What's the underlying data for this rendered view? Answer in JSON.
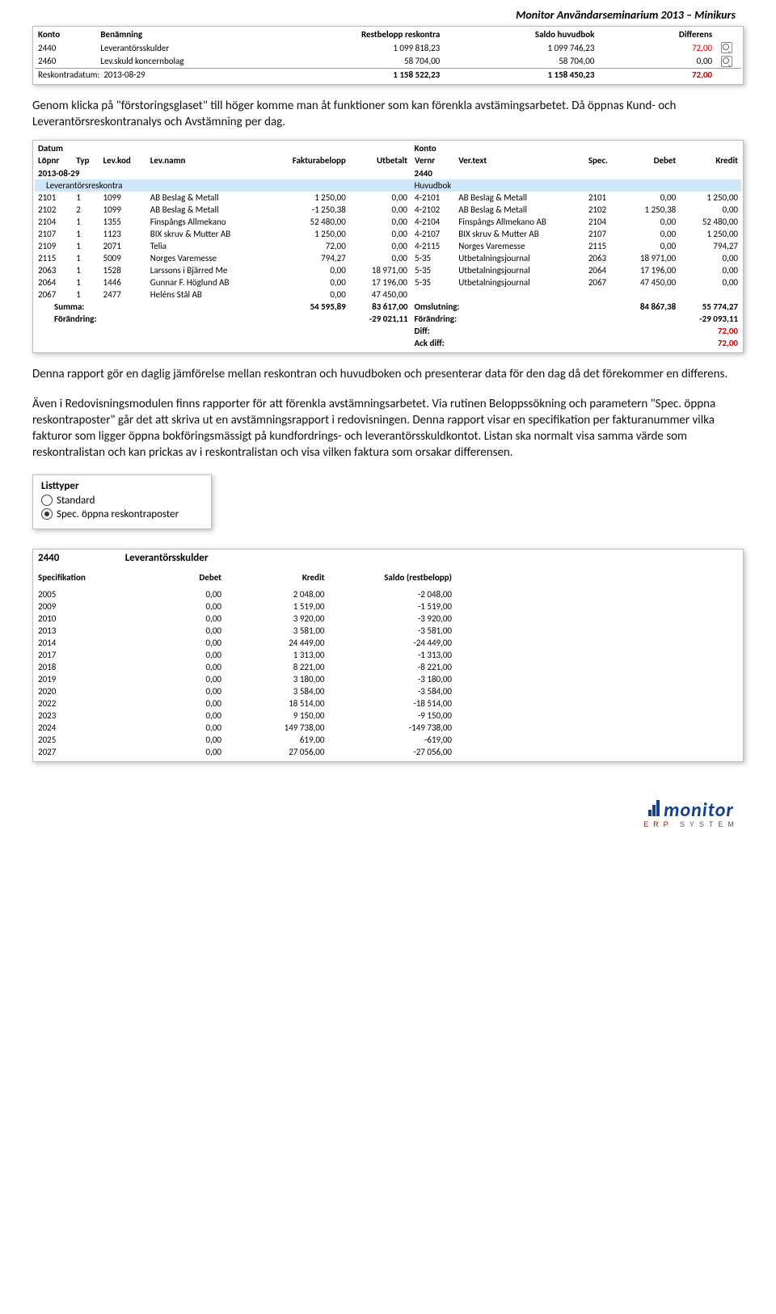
{
  "header_text": "Monitor Användarseminarium 2013 – Minikurs",
  "table1": {
    "headers": [
      "Konto",
      "Benämning",
      "Restbelopp reskontra",
      "Saldo huvudbok",
      "Differens"
    ],
    "rows": [
      {
        "konto": "2440",
        "benamning": "Leverantörsskulder",
        "rest": "1 099 818,23",
        "saldo": "1 099 746,23",
        "diff": "72,00",
        "diffred": true,
        "mag": true
      },
      {
        "konto": "2460",
        "benamning": "Lev.skuld koncernbolag",
        "rest": "58 704,00",
        "saldo": "58 704,00",
        "diff": "0,00",
        "diffred": false,
        "mag": true
      }
    ],
    "footer": {
      "label": "Reskontradatum:",
      "date": "2013-08-29",
      "rest": "1 158 522,23",
      "saldo": "1 158 450,23",
      "diff": "72,00"
    }
  },
  "paragraph1_a": "Genom klicka på \"förstoringsglaset\" till höger komme man åt funktioner som kan förenkla avstämingsarbetet. Då öppnas Kund- och Leverantörsreskontranalys och Avstämning per dag.",
  "table2": {
    "left_headers": [
      "Datum",
      "",
      "",
      "",
      "",
      "",
      "",
      ""
    ],
    "left_sub": [
      "Löpnr",
      "Typ",
      "Lev.kod",
      "Lev.namn",
      "Fakturabelopp",
      "Utbetalt"
    ],
    "right_sub": [
      "Konto",
      "Vernr",
      "Ver.text",
      "Spec.",
      "Debet",
      "Kredit"
    ],
    "date": "2013-08-29",
    "konto": "2440",
    "left_label": "Leverantörsreskontra",
    "right_label": "Huvudbok",
    "rows_left": [
      {
        "lopnr": "2101",
        "typ": "1",
        "kod": "1099",
        "namn": "AB Beslag & Metall",
        "fb": "1 250,00",
        "ut": "0,00"
      },
      {
        "lopnr": "2102",
        "typ": "2",
        "kod": "1099",
        "namn": "AB Beslag & Metall",
        "fb": "-1 250,38",
        "ut": "0,00"
      },
      {
        "lopnr": "2104",
        "typ": "1",
        "kod": "1355",
        "namn": "Finspångs Allmekano",
        "fb": "52 480,00",
        "ut": "0,00"
      },
      {
        "lopnr": "2107",
        "typ": "1",
        "kod": "1123",
        "namn": "BIX skruv & Mutter AB",
        "fb": "1 250,00",
        "ut": "0,00"
      },
      {
        "lopnr": "2109",
        "typ": "1",
        "kod": "2071",
        "namn": "Telia",
        "fb": "72,00",
        "ut": "0,00"
      },
      {
        "lopnr": "2115",
        "typ": "1",
        "kod": "5009",
        "namn": "Norges Varemesse",
        "fb": "794,27",
        "ut": "0,00"
      },
      {
        "lopnr": "2063",
        "typ": "1",
        "kod": "1528",
        "namn": "Larssons i Bjärred Me",
        "fb": "0,00",
        "ut": "18 971,00"
      },
      {
        "lopnr": "2064",
        "typ": "1",
        "kod": "1446",
        "namn": "Gunnar F. Höglund AB",
        "fb": "0,00",
        "ut": "17 196,00"
      },
      {
        "lopnr": "2067",
        "typ": "1",
        "kod": "2477",
        "namn": "Heléns Stål AB",
        "fb": "0,00",
        "ut": "47 450,00"
      }
    ],
    "rows_right": [
      {
        "vernr": "4-2101",
        "text": "AB Beslag & Metall",
        "spec": "2101",
        "deb": "0,00",
        "kre": "1 250,00"
      },
      {
        "vernr": "4-2102",
        "text": "AB Beslag & Metall",
        "spec": "2102",
        "deb": "1 250,38",
        "kre": "0,00"
      },
      {
        "vernr": "4-2104",
        "text": "Finspångs Allmekano AB",
        "spec": "2104",
        "deb": "0,00",
        "kre": "52 480,00"
      },
      {
        "vernr": "4-2107",
        "text": "BIX skruv & Mutter AB",
        "spec": "2107",
        "deb": "0,00",
        "kre": "1 250,00"
      },
      {
        "vernr": "4-2115",
        "text": "Norges Varemesse",
        "spec": "2115",
        "deb": "0,00",
        "kre": "794,27"
      },
      {
        "vernr": "5-35",
        "text": "Utbetalningsjournal",
        "spec": "2063",
        "deb": "18 971,00",
        "kre": "0,00"
      },
      {
        "vernr": "5-35",
        "text": "Utbetalningsjournal",
        "spec": "2064",
        "deb": "17 196,00",
        "kre": "0,00"
      },
      {
        "vernr": "5-35",
        "text": "Utbetalningsjournal",
        "spec": "2067",
        "deb": "47 450,00",
        "kre": "0,00"
      }
    ],
    "sum_left": {
      "label": "Summa:",
      "fb": "54 595,89",
      "ut": "83 617,00"
    },
    "chg_left": {
      "label": "Förändring:",
      "val": "-29 021,11"
    },
    "sum_right": {
      "oms_label": "Omslutning:",
      "deb": "84 867,38",
      "kre": "55 774,27",
      "for_label": "Förändring:",
      "for": "-29 093,11",
      "diff_label": "Diff:",
      "diff": "72,00",
      "ack_label": "Ack diff:",
      "ack": "72,00"
    }
  },
  "paragraph2a": "Denna rapport gör en daglig jämförelse mellan reskontran och huvudboken och presenterar data för den dag då det förekommer en differens.",
  "paragraph2b": "Även i Redovisningsmodulen finns rapporter för att förenkla avstämningsarbetet. Via rutinen Beloppssökning och parametern \"Spec. öppna reskontraposter\" går det att skriva ut en avstämningsrapport i redovisningen. Denna rapport visar en specifikation per fakturanummer vilka fakturor som ligger öppna bokföringsmässigt på kundfordrings- och leverantörsskuldkontot. Listan ska normalt visa samma värde som reskontralistan och kan prickas av i reskontralistan och visa vilken faktura som orsakar differensen.",
  "listtyper": {
    "title": "Listtyper",
    "opt1": "Standard",
    "opt2": "Spec. öppna reskontraposter"
  },
  "table3": {
    "konto": "2440",
    "benamning": "Leverantörsskulder",
    "headers": [
      "Specifikation",
      "Debet",
      "Kredit",
      "Saldo (restbelopp)"
    ],
    "rows": [
      {
        "spec": "2005",
        "deb": "0,00",
        "kre": "2 048,00",
        "saldo": "-2 048,00"
      },
      {
        "spec": "2009",
        "deb": "0,00",
        "kre": "1 519,00",
        "saldo": "-1 519,00"
      },
      {
        "spec": "2010",
        "deb": "0,00",
        "kre": "3 920,00",
        "saldo": "-3 920,00"
      },
      {
        "spec": "2013",
        "deb": "0,00",
        "kre": "3 581,00",
        "saldo": "-3 581,00"
      },
      {
        "spec": "2014",
        "deb": "0,00",
        "kre": "24 449,00",
        "saldo": "-24 449,00"
      },
      {
        "spec": "2017",
        "deb": "0,00",
        "kre": "1 313,00",
        "saldo": "-1 313,00"
      },
      {
        "spec": "2018",
        "deb": "0,00",
        "kre": "8 221,00",
        "saldo": "-8 221,00"
      },
      {
        "spec": "2019",
        "deb": "0,00",
        "kre": "3 180,00",
        "saldo": "-3 180,00"
      },
      {
        "spec": "2020",
        "deb": "0,00",
        "kre": "3 584,00",
        "saldo": "-3 584,00"
      },
      {
        "spec": "2022",
        "deb": "0,00",
        "kre": "18 514,00",
        "saldo": "-18 514,00"
      },
      {
        "spec": "2023",
        "deb": "0,00",
        "kre": "9 150,00",
        "saldo": "-9 150,00"
      },
      {
        "spec": "2024",
        "deb": "0,00",
        "kre": "149 738,00",
        "saldo": "-149 738,00"
      },
      {
        "spec": "2025",
        "deb": "0,00",
        "kre": "619,00",
        "saldo": "-619,00"
      },
      {
        "spec": "2027",
        "deb": "0,00",
        "kre": "27 056,00",
        "saldo": "-27 056,00"
      }
    ]
  },
  "logo": {
    "main": "monitor",
    "sub1": "ERP",
    "sub2": "SYSTEM"
  }
}
